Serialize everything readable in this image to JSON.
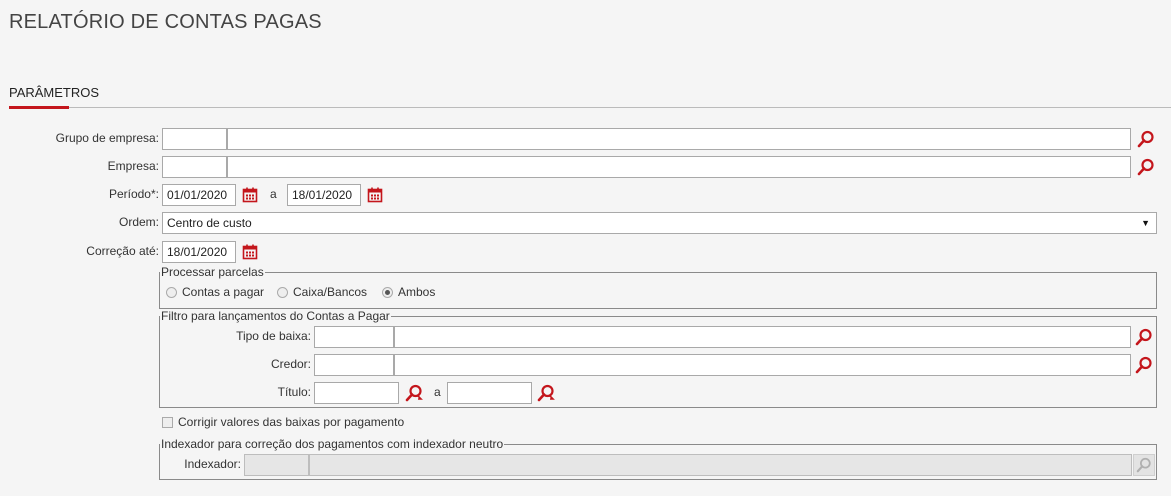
{
  "page": {
    "title": "RELATÓRIO DE CONTAS PAGAS",
    "section": "PARÂMETROS"
  },
  "colors": {
    "accent": "#c4161c",
    "background": "#f5f5f5"
  },
  "fields": {
    "grupo_empresa": {
      "label": "Grupo de empresa:",
      "code": "",
      "name": ""
    },
    "empresa": {
      "label": "Empresa:",
      "code": "",
      "name": ""
    },
    "periodo": {
      "label": "Período*:",
      "from": "01/01/2020",
      "sep": "a",
      "to": "18/01/2020"
    },
    "ordem": {
      "label": "Ordem:",
      "value": "Centro de custo"
    },
    "correcao": {
      "label": "Correção até:",
      "value": "18/01/2020"
    }
  },
  "processar": {
    "legend": "Processar parcelas",
    "options": [
      {
        "label": "Contas a pagar",
        "selected": false
      },
      {
        "label": "Caixa/Bancos",
        "selected": false
      },
      {
        "label": "Ambos",
        "selected": true
      }
    ]
  },
  "filtro": {
    "legend": "Filtro para lançamentos do Contas a Pagar",
    "tipo_baixa": {
      "label": "Tipo de baixa:",
      "code": "",
      "name": ""
    },
    "credor": {
      "label": "Credor:",
      "code": "",
      "name": ""
    },
    "titulo": {
      "label": "Título:",
      "from": "",
      "sep": "a",
      "to": ""
    }
  },
  "corrigir": {
    "label": "Corrigir valores das baixas por pagamento",
    "checked": false
  },
  "indexador": {
    "legend": "Indexador para correção dos pagamentos com indexador neutro",
    "label": "Indexador:",
    "code": "",
    "name": ""
  },
  "icons": {
    "search": "search-icon",
    "calendar": "calendar-icon",
    "search_advanced": "search-advanced-icon"
  }
}
